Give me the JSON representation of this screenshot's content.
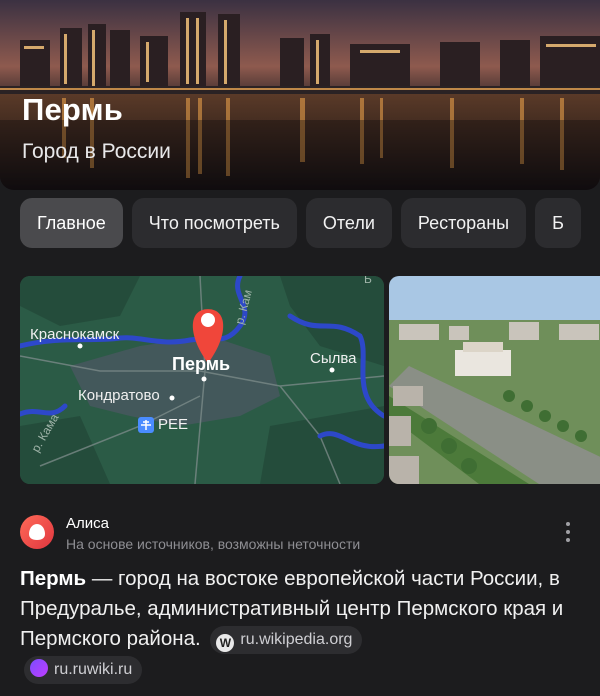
{
  "hero": {
    "title": "Пермь",
    "subtitle": "Город в России"
  },
  "tabs": [
    {
      "label": "Главное",
      "active": true
    },
    {
      "label": "Что посмотреть",
      "active": false
    },
    {
      "label": "Отели",
      "active": false
    },
    {
      "label": "Рестораны",
      "active": false
    },
    {
      "label": "Б",
      "active": false
    }
  ],
  "map": {
    "city": "Пермь",
    "labels": {
      "krasnokamsk": "Краснокамск",
      "kondratovo": "Кондратово",
      "airport": "PEE",
      "sylva": "Сылва",
      "river_kama": "р. Кама",
      "river_kama_top": "р. Кам",
      "edge_top": "Б"
    },
    "colors": {
      "land": "#2b5b46",
      "river": "#2d48c9",
      "pin": "#f0463a"
    }
  },
  "alice": {
    "name": "Алиса",
    "note": "На основе источников, возможны неточности"
  },
  "answer": {
    "bold": "Пермь",
    "text": " — город на востоке европейской части России, в Предуралье, административный центр Пермского края и Пермского района."
  },
  "sources": [
    {
      "icon": "wikipedia-icon",
      "label": "ru.wikipedia.org"
    },
    {
      "icon": "ruwiki-icon",
      "label": "ru.ruwiki.ru"
    }
  ]
}
